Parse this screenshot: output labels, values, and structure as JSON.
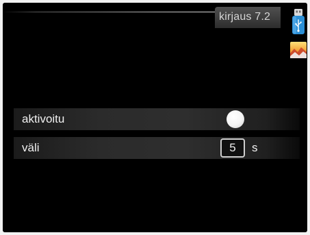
{
  "header": {
    "title": "kirjaus 7.2"
  },
  "icons": {
    "usb": "usb-stick-icon",
    "heating": "heating-mode-icon"
  },
  "settings": [
    {
      "label": "aktivoitu",
      "control": "toggle",
      "state": "on"
    },
    {
      "label": "väli",
      "control": "number",
      "value": "5",
      "unit": "s"
    }
  ],
  "colors": {
    "background": "#000000",
    "usb_blue": "#2b8fd6",
    "text": "#f0f0f0"
  }
}
